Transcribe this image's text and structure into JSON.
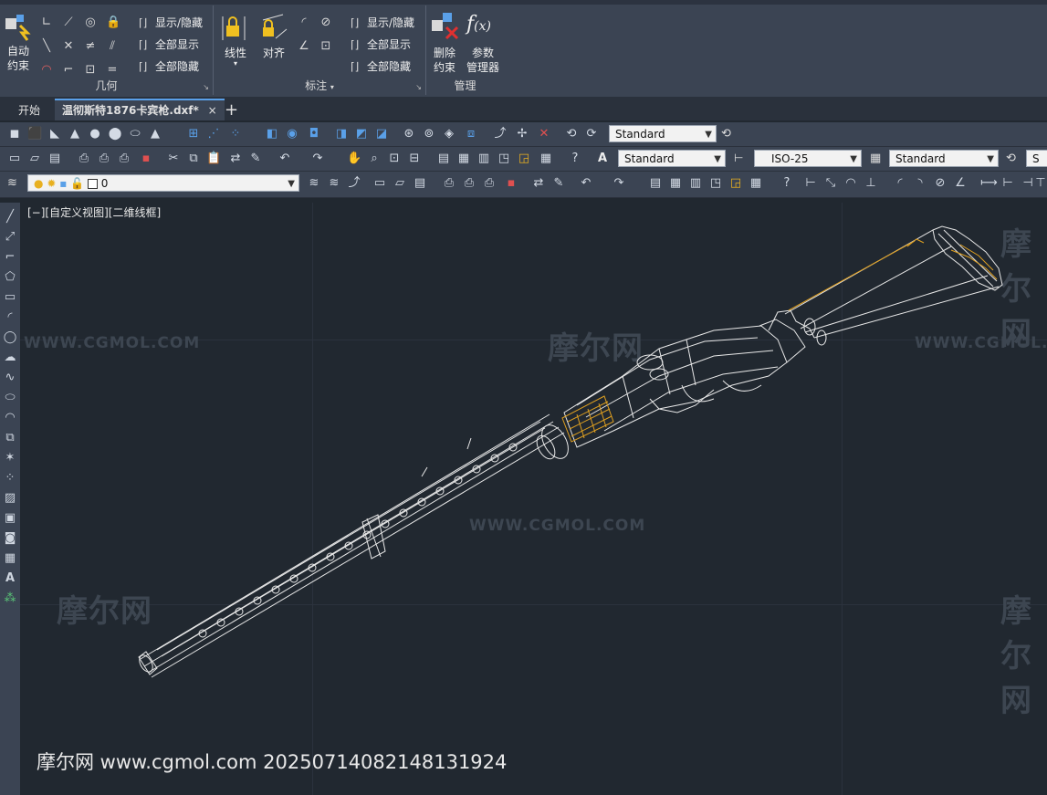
{
  "ribbon": {
    "geometry_panel": {
      "title": "几何",
      "auto_constrain_label_1": "自动",
      "auto_constrain_label_2": "约束",
      "show_hide": "显示/隐藏",
      "show_all": "全部显示",
      "hide_all": "全部隐藏"
    },
    "dimension_panel": {
      "title": "标注",
      "linear": "线性",
      "aligned": "对齐",
      "show_hide": "显示/隐藏",
      "show_all": "全部显示",
      "hide_all": "全部隐藏"
    },
    "manage_panel": {
      "title": "管理",
      "delete_label_1": "删除",
      "delete_label_2": "约束",
      "params_label_1": "参数",
      "params_label_2": "管理器"
    }
  },
  "file_tabs": {
    "start": "开始",
    "current_file": "温彻斯特1876卡宾枪.dxf*",
    "close": "×",
    "new": "+"
  },
  "toolbars": {
    "visual_style": "Standard",
    "text_style": "Standard",
    "dim_style": "ISO-25",
    "table_style": "Standard",
    "multileader_style": "S",
    "layer_name": "0"
  },
  "viewport": {
    "view_label": "[−][自定义视图][二维线框]",
    "watermark_text": "WWW.CGMOL.COM",
    "watermark_logo": "摩尔网",
    "footer_text": "摩尔网 www.cgmol.com 20250714082148131924"
  },
  "colors": {
    "model_white": "#e8e8e8",
    "model_gold": "#e0a020",
    "background": "#212830"
  }
}
